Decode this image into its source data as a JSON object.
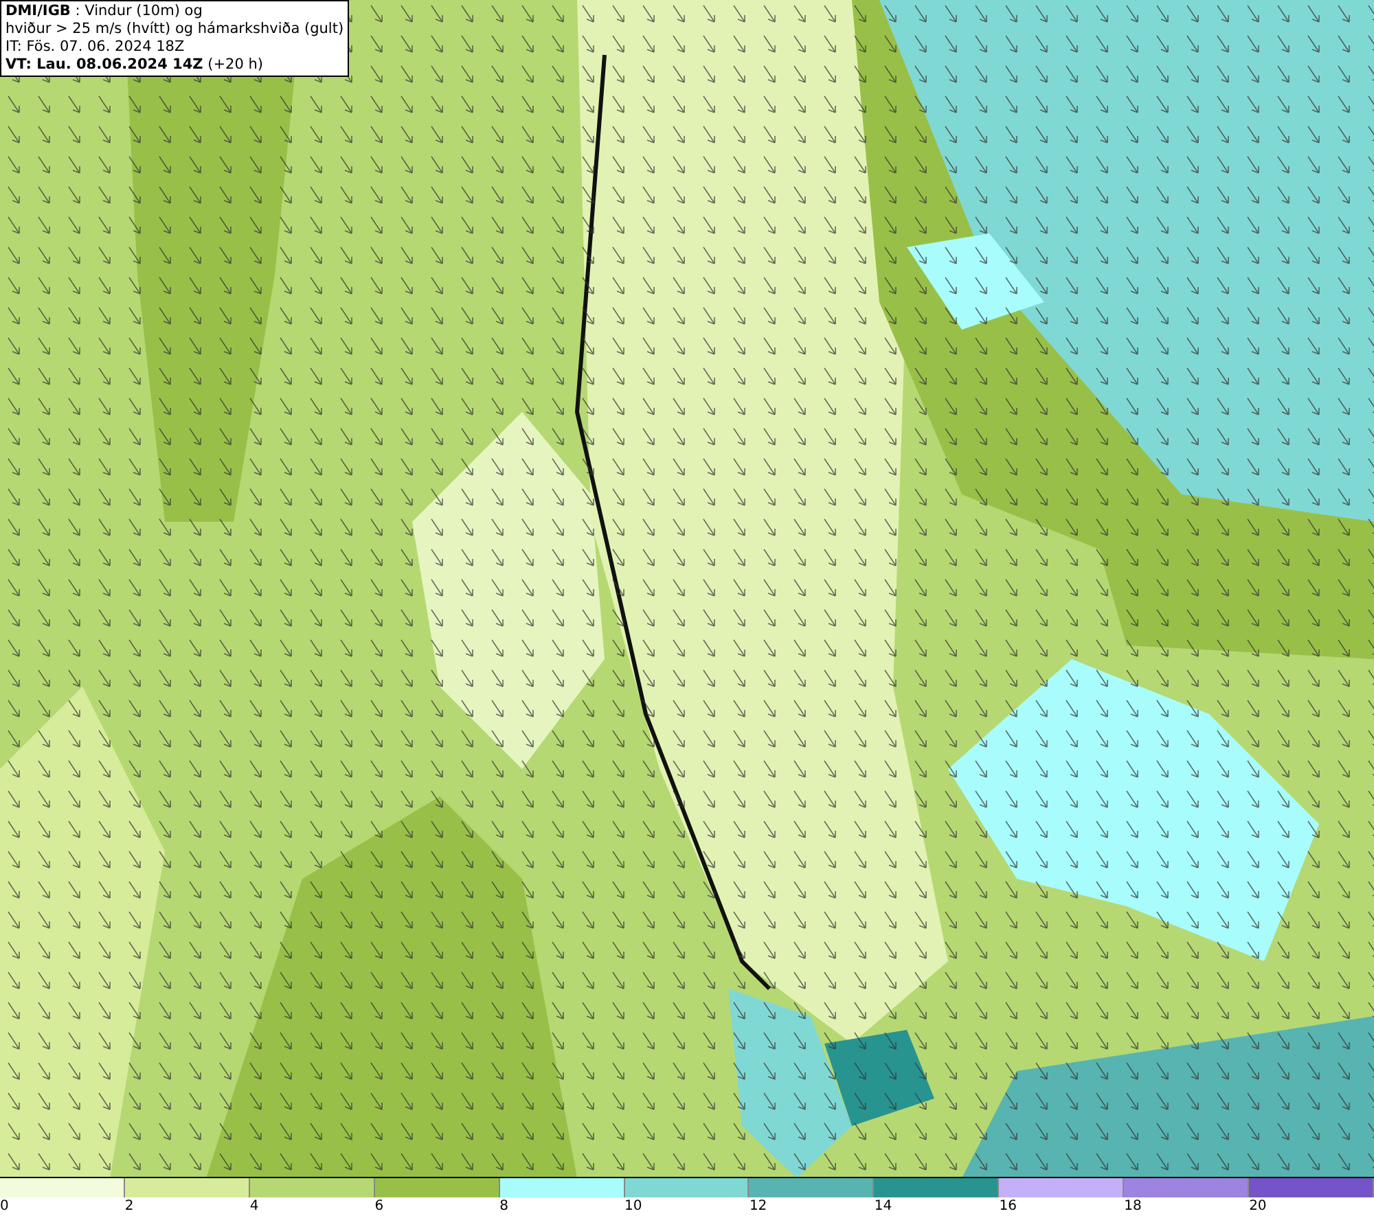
{
  "header": {
    "lines": [
      "**DMI/IGB** : Vindur (10m) og",
      "hviður > 25 m/s (hvítt) og hámarkshviða (gult)",
      "IT: Fös. 07. 06. 2024 18Z",
      "**VT: Lau. 08.06.2024 14Z** (+20 h)"
    ]
  },
  "legend": {
    "bins": [
      {
        "label": "0",
        "color": "#f2fbdc"
      },
      {
        "label": "2",
        "color": "#d6ec9a"
      },
      {
        "label": "4",
        "color": "#b6d872"
      },
      {
        "label": "6",
        "color": "#98c048"
      },
      {
        "label": "8",
        "color": "#a8fcfc"
      },
      {
        "label": "10",
        "color": "#80d8d4"
      },
      {
        "label": "12",
        "color": "#58b4b0"
      },
      {
        "label": "14",
        "color": "#289490"
      },
      {
        "label": "16",
        "color": "#c4b0f8"
      },
      {
        "label": "18",
        "color": "#9c84e0"
      },
      {
        "label": "20",
        "color": "#7454c8"
      }
    ]
  }
}
